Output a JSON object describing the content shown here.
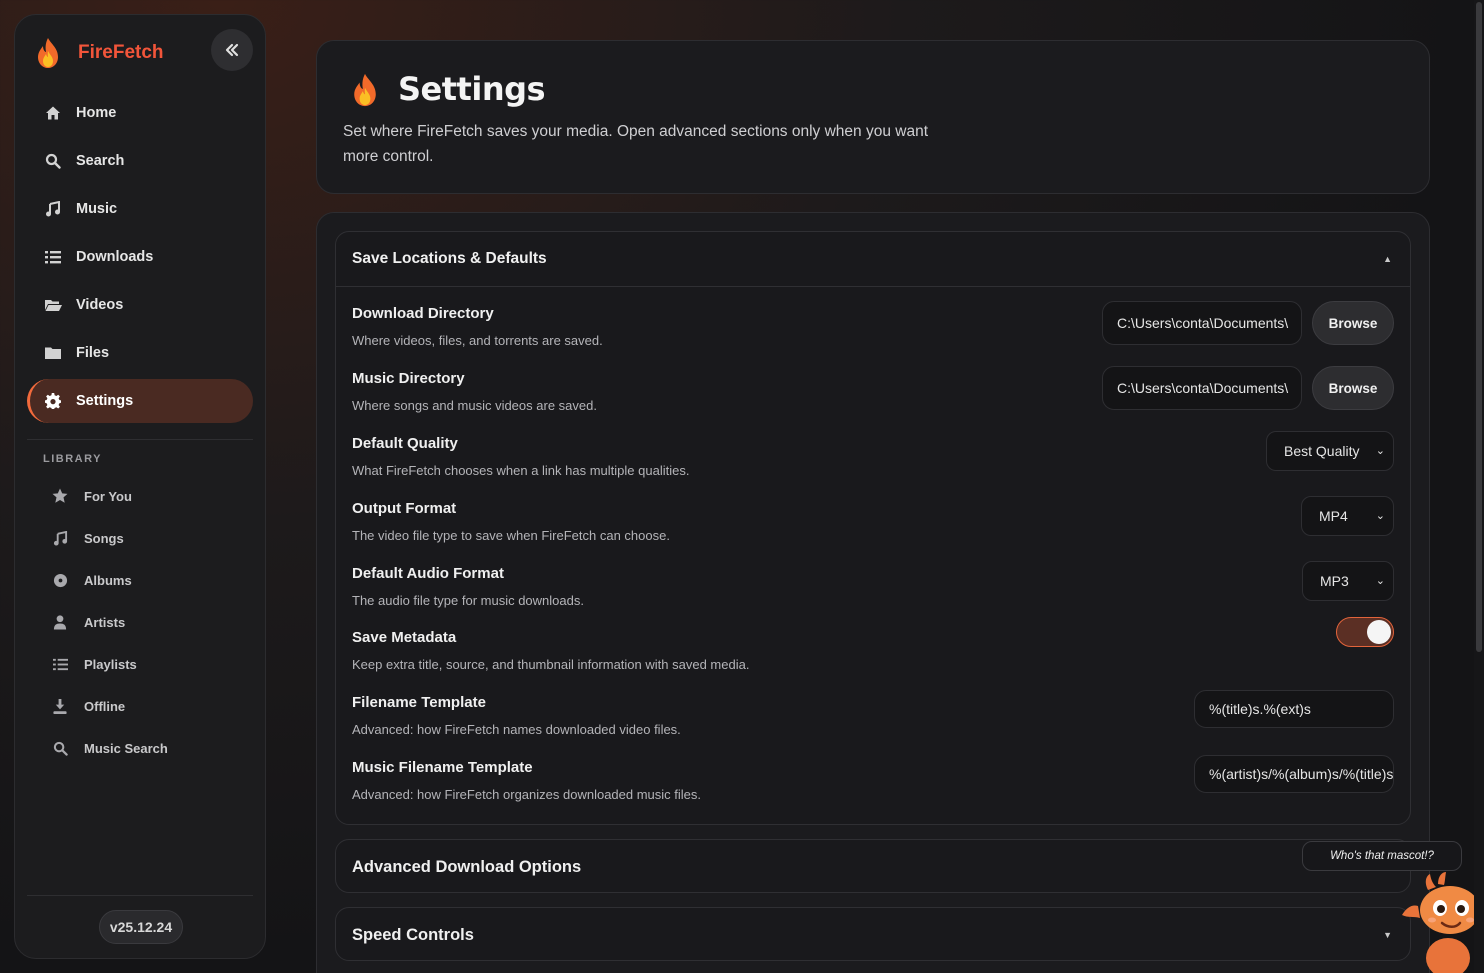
{
  "app": {
    "name": "FireFetch",
    "version": "v25.12.24",
    "accent": "#f2553a"
  },
  "nav": [
    {
      "label": "Home",
      "icon": "home-icon",
      "active": false
    },
    {
      "label": "Search",
      "icon": "search-icon",
      "active": false
    },
    {
      "label": "Music",
      "icon": "music-note-icon",
      "active": false
    },
    {
      "label": "Downloads",
      "icon": "list-icon",
      "active": false
    },
    {
      "label": "Videos",
      "icon": "folder-open-icon",
      "active": false
    },
    {
      "label": "Files",
      "icon": "folder-icon",
      "active": false
    },
    {
      "label": "Settings",
      "icon": "gear-icon",
      "active": true
    }
  ],
  "library": {
    "title": "LIBRARY",
    "items": [
      {
        "label": "For You",
        "icon": "star-icon"
      },
      {
        "label": "Songs",
        "icon": "music-note-icon"
      },
      {
        "label": "Albums",
        "icon": "disc-icon"
      },
      {
        "label": "Artists",
        "icon": "user-icon"
      },
      {
        "label": "Playlists",
        "icon": "list-icon"
      },
      {
        "label": "Offline",
        "icon": "download-icon"
      },
      {
        "label": "Music Search",
        "icon": "search-icon"
      }
    ]
  },
  "header": {
    "title": "Settings",
    "subtitle": "Set where FireFetch saves your media. Open advanced sections only when you want more control."
  },
  "sections": {
    "save_locations": {
      "title": "Save Locations & Defaults",
      "expanded": true,
      "rows": {
        "download_dir": {
          "label": "Download Directory",
          "desc": "Where videos, files, and torrents are saved.",
          "value": "C:\\Users\\conta\\Documents\\",
          "button": "Browse"
        },
        "music_dir": {
          "label": "Music Directory",
          "desc": "Where songs and music videos are saved.",
          "value": "C:\\Users\\conta\\Documents\\",
          "button": "Browse"
        },
        "quality": {
          "label": "Default Quality",
          "desc": "What FireFetch chooses when a link has multiple qualities.",
          "value": "Best Quality"
        },
        "output_format": {
          "label": "Output Format",
          "desc": "The video file type to save when FireFetch can choose.",
          "value": "MP4"
        },
        "audio_format": {
          "label": "Default Audio Format",
          "desc": "The audio file type for music downloads.",
          "value": "MP3"
        },
        "metadata": {
          "label": "Save Metadata",
          "desc": "Keep extra title, source, and thumbnail information with saved media.",
          "on": true
        },
        "filename_template": {
          "label": "Filename Template",
          "desc": "Advanced: how FireFetch names downloaded video files.",
          "value": "%(title)s.%(ext)s"
        },
        "music_filename_template": {
          "label": "Music Filename Template",
          "desc": "Advanced: how FireFetch organizes downloaded music files.",
          "value": "%(artist)s/%(album)s/%(title)s"
        }
      }
    },
    "advanced_download": {
      "title": "Advanced Download Options"
    },
    "speed_controls": {
      "title": "Speed Controls"
    }
  },
  "mascot": {
    "bubble": "Who's that mascot!?"
  }
}
